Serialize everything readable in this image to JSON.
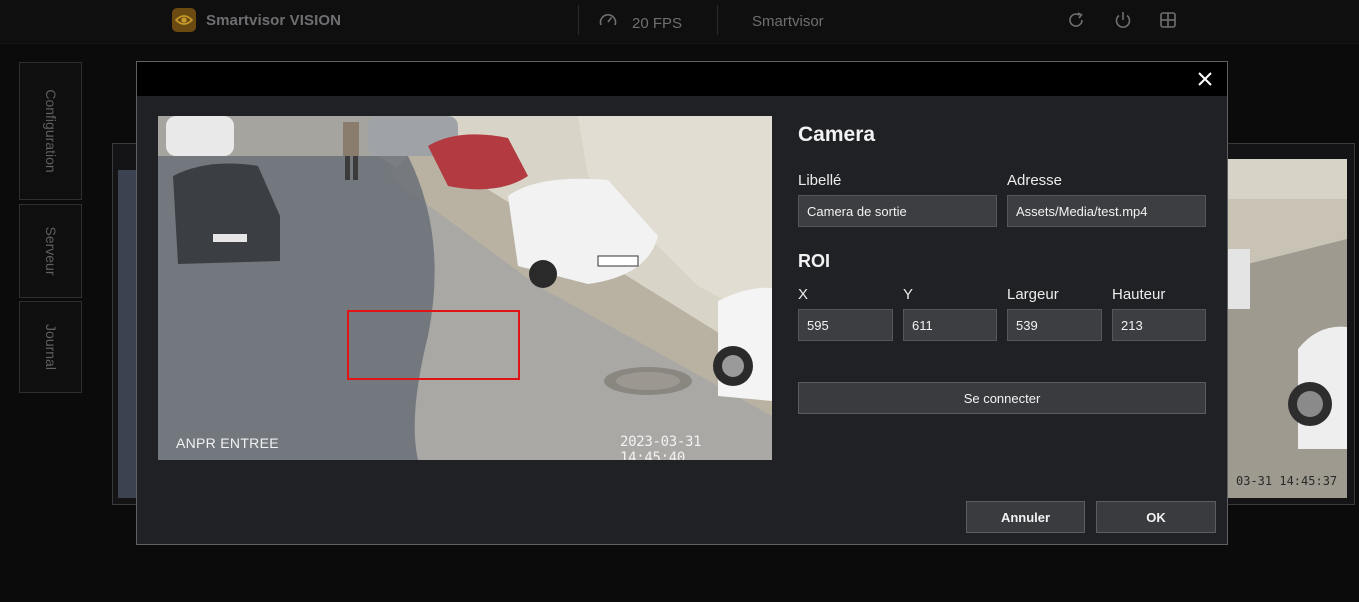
{
  "app": {
    "brand_name": "Smartvisor VISION",
    "fps_label": "20 FPS",
    "app_name": "Smartvisor",
    "brand_color": "#6b4a12"
  },
  "toolbar_icons": [
    "refresh-icon",
    "power-icon",
    "grid-icon"
  ],
  "sidebar": {
    "items": [
      {
        "label": "Configuration"
      },
      {
        "label": "Serveur"
      },
      {
        "label": "Journal"
      }
    ]
  },
  "background_feed": {
    "timestamp": "03-31 14:45:37"
  },
  "dialog": {
    "preview": {
      "camera_label": "ANPR ENTREE",
      "timestamp": "2023-03-31 14:45:40",
      "roi_color": "#e01414"
    },
    "camera_section_title": "Camera",
    "libelle": {
      "label": "Libellé",
      "value": "Camera de sortie"
    },
    "adresse": {
      "label": "Adresse",
      "value": "Assets/Media/test.mp4"
    },
    "roi_section_title": "ROI",
    "roi": {
      "x": {
        "label": "X",
        "value": "595"
      },
      "y": {
        "label": "Y",
        "value": "611"
      },
      "largeur": {
        "label": "Largeur",
        "value": "539"
      },
      "hauteur": {
        "label": "Hauteur",
        "value": "213"
      }
    },
    "connect_button": "Se connecter",
    "cancel_button": "Annuler",
    "ok_button": "OK"
  }
}
